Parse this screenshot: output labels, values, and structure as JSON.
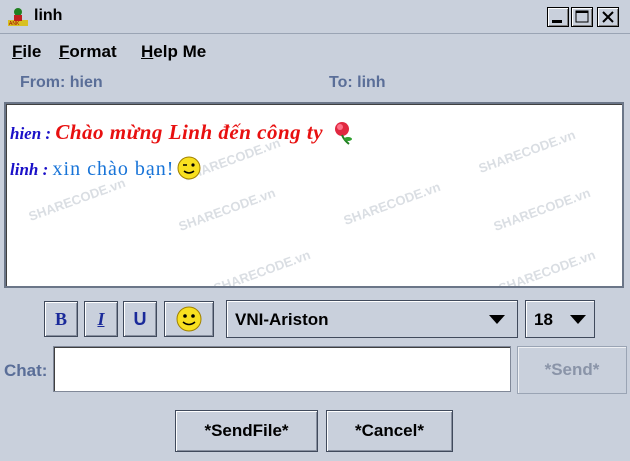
{
  "window": {
    "title": "linh"
  },
  "menu": [
    {
      "label": "File",
      "mnemonic": "F",
      "rest": "ile"
    },
    {
      "label": "Format",
      "mnemonic": "F",
      "rest": "ormat"
    },
    {
      "label": "Help Me",
      "mnemonic": "H",
      "rest": "elp Me"
    }
  ],
  "header": {
    "from": "From: hien",
    "to": "To: linh"
  },
  "messages": [
    {
      "sender": "hien : ",
      "text": "Chào mừng Linh đến công ty",
      "icon": "rose-icon"
    },
    {
      "sender": "linh : ",
      "text": "xin chào bạn!",
      "icon": "smiley-icon"
    }
  ],
  "watermark": "SHARECODE.vn",
  "toolbar": {
    "bold_label": "B",
    "italic_label": "I",
    "underline_label": "U",
    "font_value": "VNI-Ariston",
    "size_value": "18"
  },
  "input": {
    "label": "Chat:",
    "value": ""
  },
  "buttons": {
    "send": "*Send*",
    "sendfile": "*SendFile*",
    "cancel": "*Cancel*"
  },
  "colors": {
    "sender": "#1a10c8",
    "msg1": "#e81010",
    "msg2": "#1874d8",
    "header": "#5a6e98"
  }
}
